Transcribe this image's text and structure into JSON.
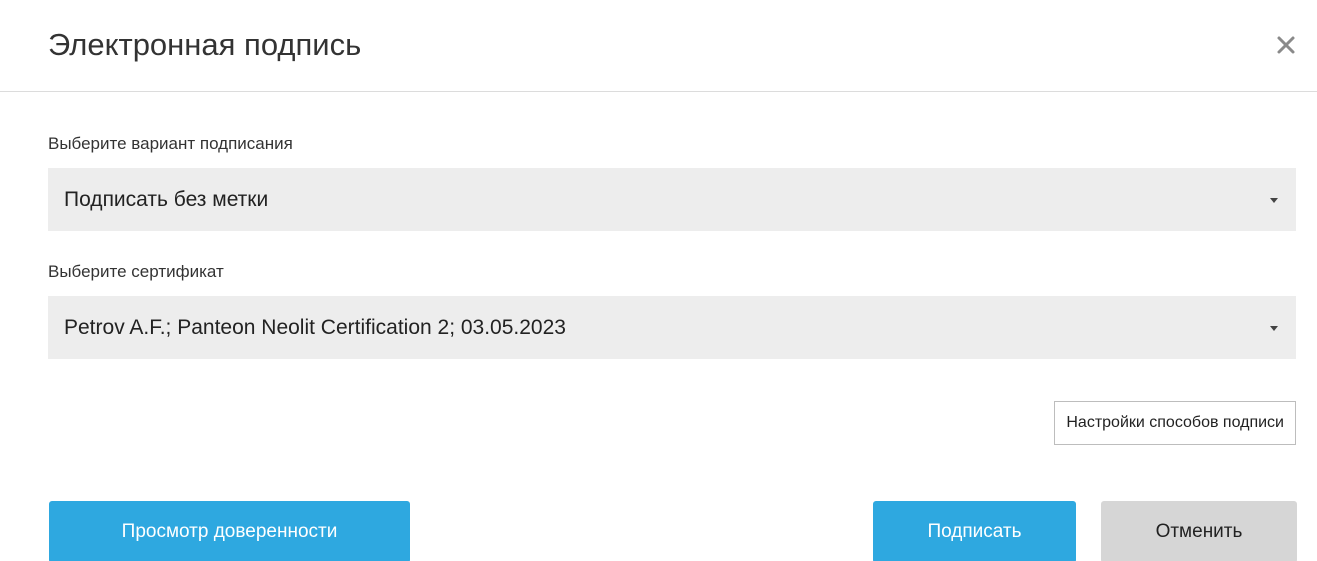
{
  "dialog": {
    "title": "Электронная подпись",
    "close_icon": "close-icon"
  },
  "signing_variant": {
    "label": "Выберите вариант подписания",
    "selected": "Подписать без метки"
  },
  "certificate": {
    "label": "Выберите сертификат",
    "selected": "Petrov A.F.; Panteon Neolit Certification 2; 03.05.2023"
  },
  "settings_button": {
    "label": "Настройки способов подписи"
  },
  "footer": {
    "view_power_of_attorney": "Просмотр доверенности",
    "sign": "Подписать",
    "cancel": "Отменить"
  },
  "colors": {
    "primary": "#2ea8e0",
    "secondary": "#d6d6d6",
    "select_bg": "#ededed"
  }
}
